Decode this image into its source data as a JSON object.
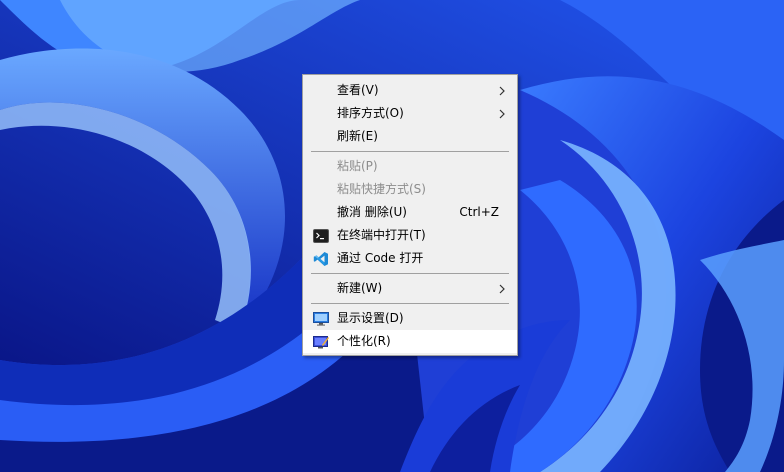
{
  "desktop": {
    "wallpaper": "windows-11-bloom-wallpaper",
    "colors": {
      "base": "#1f3fd6",
      "light": "#4f8bff",
      "highlight": "#9cc8ff",
      "dark": "#0a1a8a"
    }
  },
  "context_menu": {
    "items": [
      {
        "label": "查看(V)",
        "shortcut": "",
        "submenu": true,
        "disabled": false,
        "icon": ""
      },
      {
        "label": "排序方式(O)",
        "shortcut": "",
        "submenu": true,
        "disabled": false,
        "icon": ""
      },
      {
        "label": "刷新(E)",
        "shortcut": "",
        "submenu": false,
        "disabled": false,
        "icon": ""
      },
      {
        "label": "粘贴(P)",
        "shortcut": "",
        "submenu": false,
        "disabled": true,
        "icon": ""
      },
      {
        "label": "粘贴快捷方式(S)",
        "shortcut": "",
        "submenu": false,
        "disabled": true,
        "icon": ""
      },
      {
        "label": "撤消 删除(U)",
        "shortcut": "Ctrl+Z",
        "submenu": false,
        "disabled": false,
        "icon": ""
      },
      {
        "label": "在终端中打开(T)",
        "shortcut": "",
        "submenu": false,
        "disabled": false,
        "icon": "terminal-icon"
      },
      {
        "label": "通过 Code 打开",
        "shortcut": "",
        "submenu": false,
        "disabled": false,
        "icon": "vscode-icon"
      },
      {
        "label": "新建(W)",
        "shortcut": "",
        "submenu": true,
        "disabled": false,
        "icon": ""
      },
      {
        "label": "显示设置(D)",
        "shortcut": "",
        "submenu": false,
        "disabled": false,
        "icon": "display-settings-icon"
      },
      {
        "label": "个性化(R)",
        "shortcut": "",
        "submenu": false,
        "disabled": false,
        "icon": "personalize-icon",
        "hovered": true
      }
    ]
  }
}
